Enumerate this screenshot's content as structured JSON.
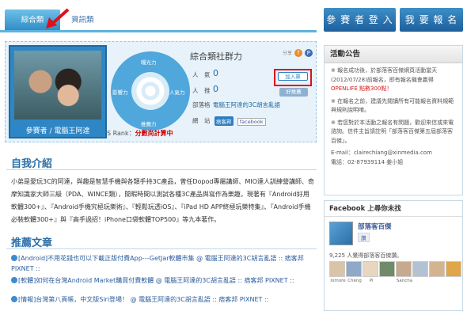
{
  "tabs": {
    "active": "綜合類",
    "inactive": "資訊類"
  },
  "header": {
    "login_label": "參 賽 者 登 入",
    "signup_label": "我 要 報 名"
  },
  "profile": {
    "caption": "參賽者 / 電腦王阿達",
    "title": "綜合類社群力",
    "icons_label": "分享",
    "radar_labels": [
      "曝光力",
      "人氣力",
      "推薦力",
      "影響力"
    ],
    "popularity_label": "人　氣",
    "popularity_value": "0",
    "recommend_label": "人　推",
    "recommend_value": "0",
    "blog_label": "部落格",
    "blog_value": "電腦王阿達的3C胡言亂語",
    "site_label": "網　站",
    "site_badge": "痞客邦",
    "site_fb": "facebook",
    "add_label": "加入票",
    "friend_label": "好推薦",
    "s_rank_label": "S Rank：",
    "s_rank_value": "分數尚計算中"
  },
  "intro": {
    "heading": "自我介紹",
    "text": "小弟是愛玩3C的阿達，與趣是智慧手機與各類手持3C產品，曾任Dopod專屬講師、MIO達人訓練營講師、奇摩知識家大師三級（PDA、WINCE類），閒暇時間以測試各種3C產品與寫作為樂趣，現著有『Android好用軟體300+』、『Android手機究極玩樂術』、『輕鬆玩透iOS』、『iPad HD APP終極玩樂特集』、『Android手機必裝軟體300+』與『高手過招！iPhone口袋軟體TOP500』等九本著作。"
  },
  "articles": {
    "heading": "推薦文章",
    "items": [
      "[Android]不用花錢也可以下載正版付費App---GetJar軟體市集 @ 電腦王阿達的3C胡言亂語 :: 痞客邦 PIXNET ::",
      "[軟體]如何在台灣Android Market購買付費軟體 @ 電腦王阿達的3C胡言亂語 :: 痞客邦 PIXNET ::",
      "[情報]台灣第八頁帳，中文版Siri登場！ @ 電腦王阿達的3C胡言亂語 :: 痞客邦 PIXNET ::"
    ]
  },
  "announcement": {
    "heading": "活動公告",
    "p1": "※ 報名成功後，於部落客百傑網頁活動當天(2012/07/28)前報名，即有報名機會贏得",
    "p1_highlight": "OPENLIFE 點數300點！",
    "p2": "※ 在報名之前，建議先閱讀所有可能報名資料規範與規則說明唷。",
    "p3": "※ 若您對於本活動之報名有問題，歡迎來信或來電諮詢。信件主旨請註明「部落客百傑第五屆部落客百傑」。",
    "email": "E-mail：clairechiang@xinmedia.com",
    "phone": "電話：02-87939114 姜小姐"
  },
  "facebook": {
    "heading": "Facebook 上尋你未找",
    "page_name": "部落客百傑",
    "like_label": "讚",
    "count_text": "9,225 人覺得部落客百傑讚。",
    "faces": [
      "Iomore",
      "Cheng",
      "Pi",
      "",
      "Sancha",
      "",
      "",
      ""
    ]
  },
  "colors": {
    "accent": "#2d8cc6",
    "highlight": "#e0101a"
  }
}
